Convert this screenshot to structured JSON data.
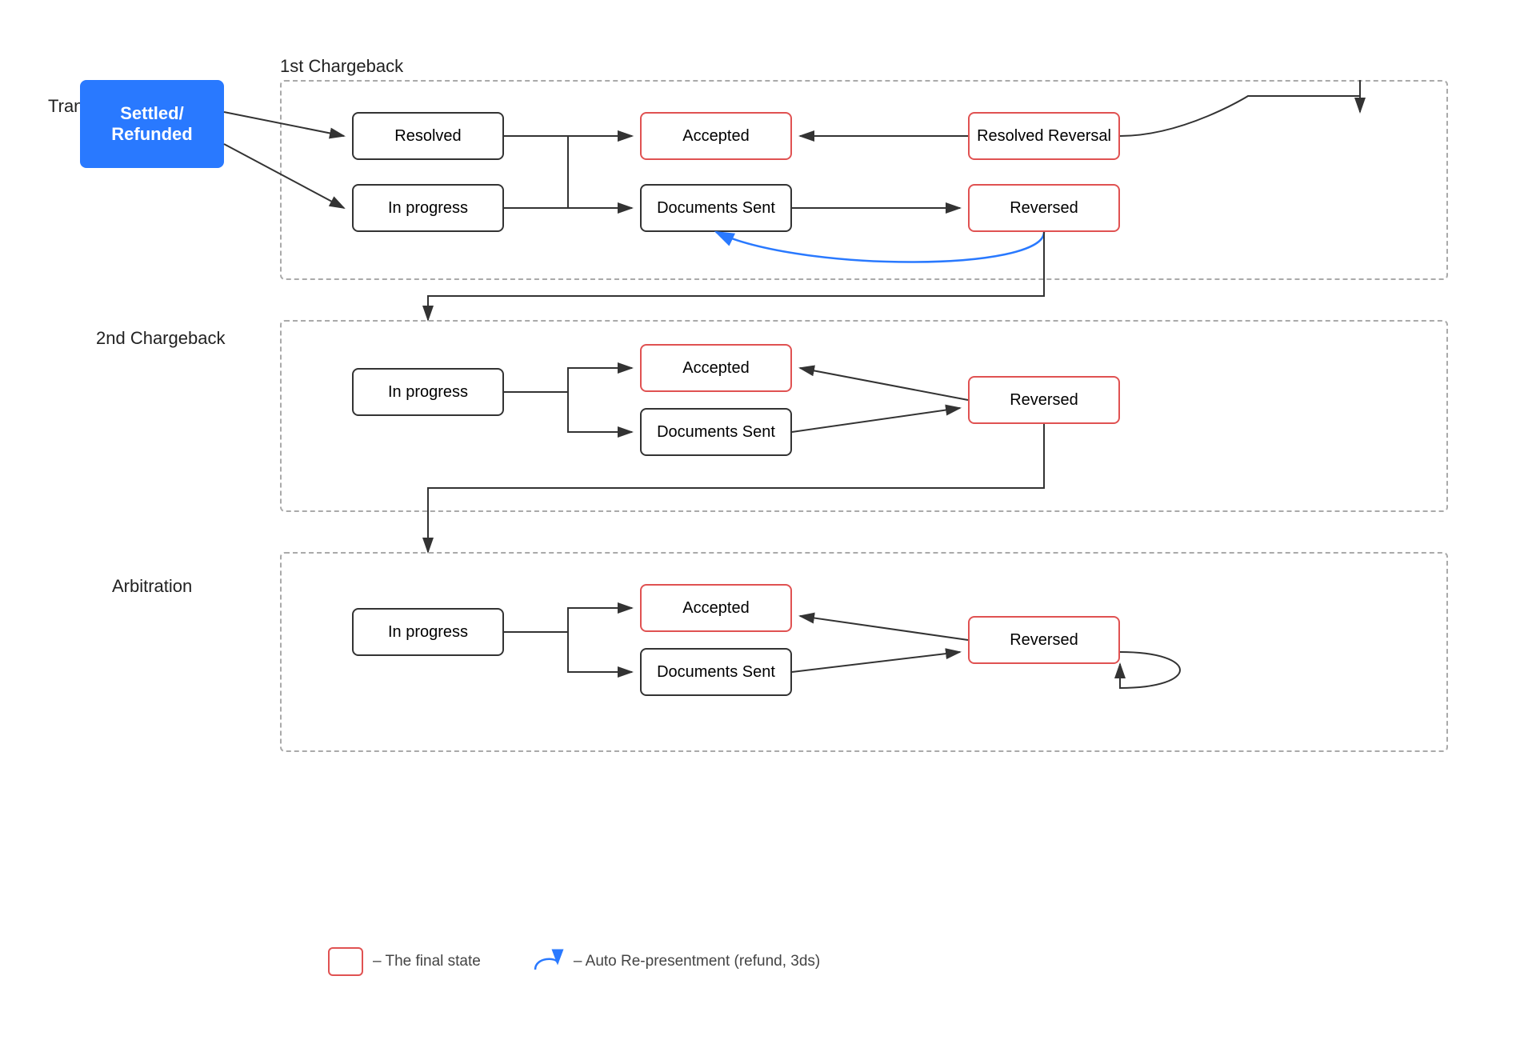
{
  "diagram": {
    "transaction_label": "Transaction",
    "transaction_node": "Settled/\nRefunded",
    "chargeback1_label": "1st Chargeback",
    "chargeback2_label": "2nd Chargeback",
    "arbitration_label": "Arbitration",
    "nodes": {
      "cb1_resolved": "Resolved",
      "cb1_in_progress": "In progress",
      "cb1_accepted": "Accepted",
      "cb1_documents_sent": "Documents Sent",
      "cb1_resolved_reversal": "Resolved Reversal",
      "cb1_reversed": "Reversed",
      "cb2_in_progress": "In progress",
      "cb2_accepted": "Accepted",
      "cb2_documents_sent": "Documents Sent",
      "cb2_reversed": "Reversed",
      "arb_in_progress": "In progress",
      "arb_accepted": "Accepted",
      "arb_documents_sent": "Documents Sent",
      "arb_reversed": "Reversed"
    },
    "legend": {
      "final_state_label": "– The final state",
      "auto_representment_label": "– Auto Re-presentment (refund, 3ds)"
    }
  }
}
